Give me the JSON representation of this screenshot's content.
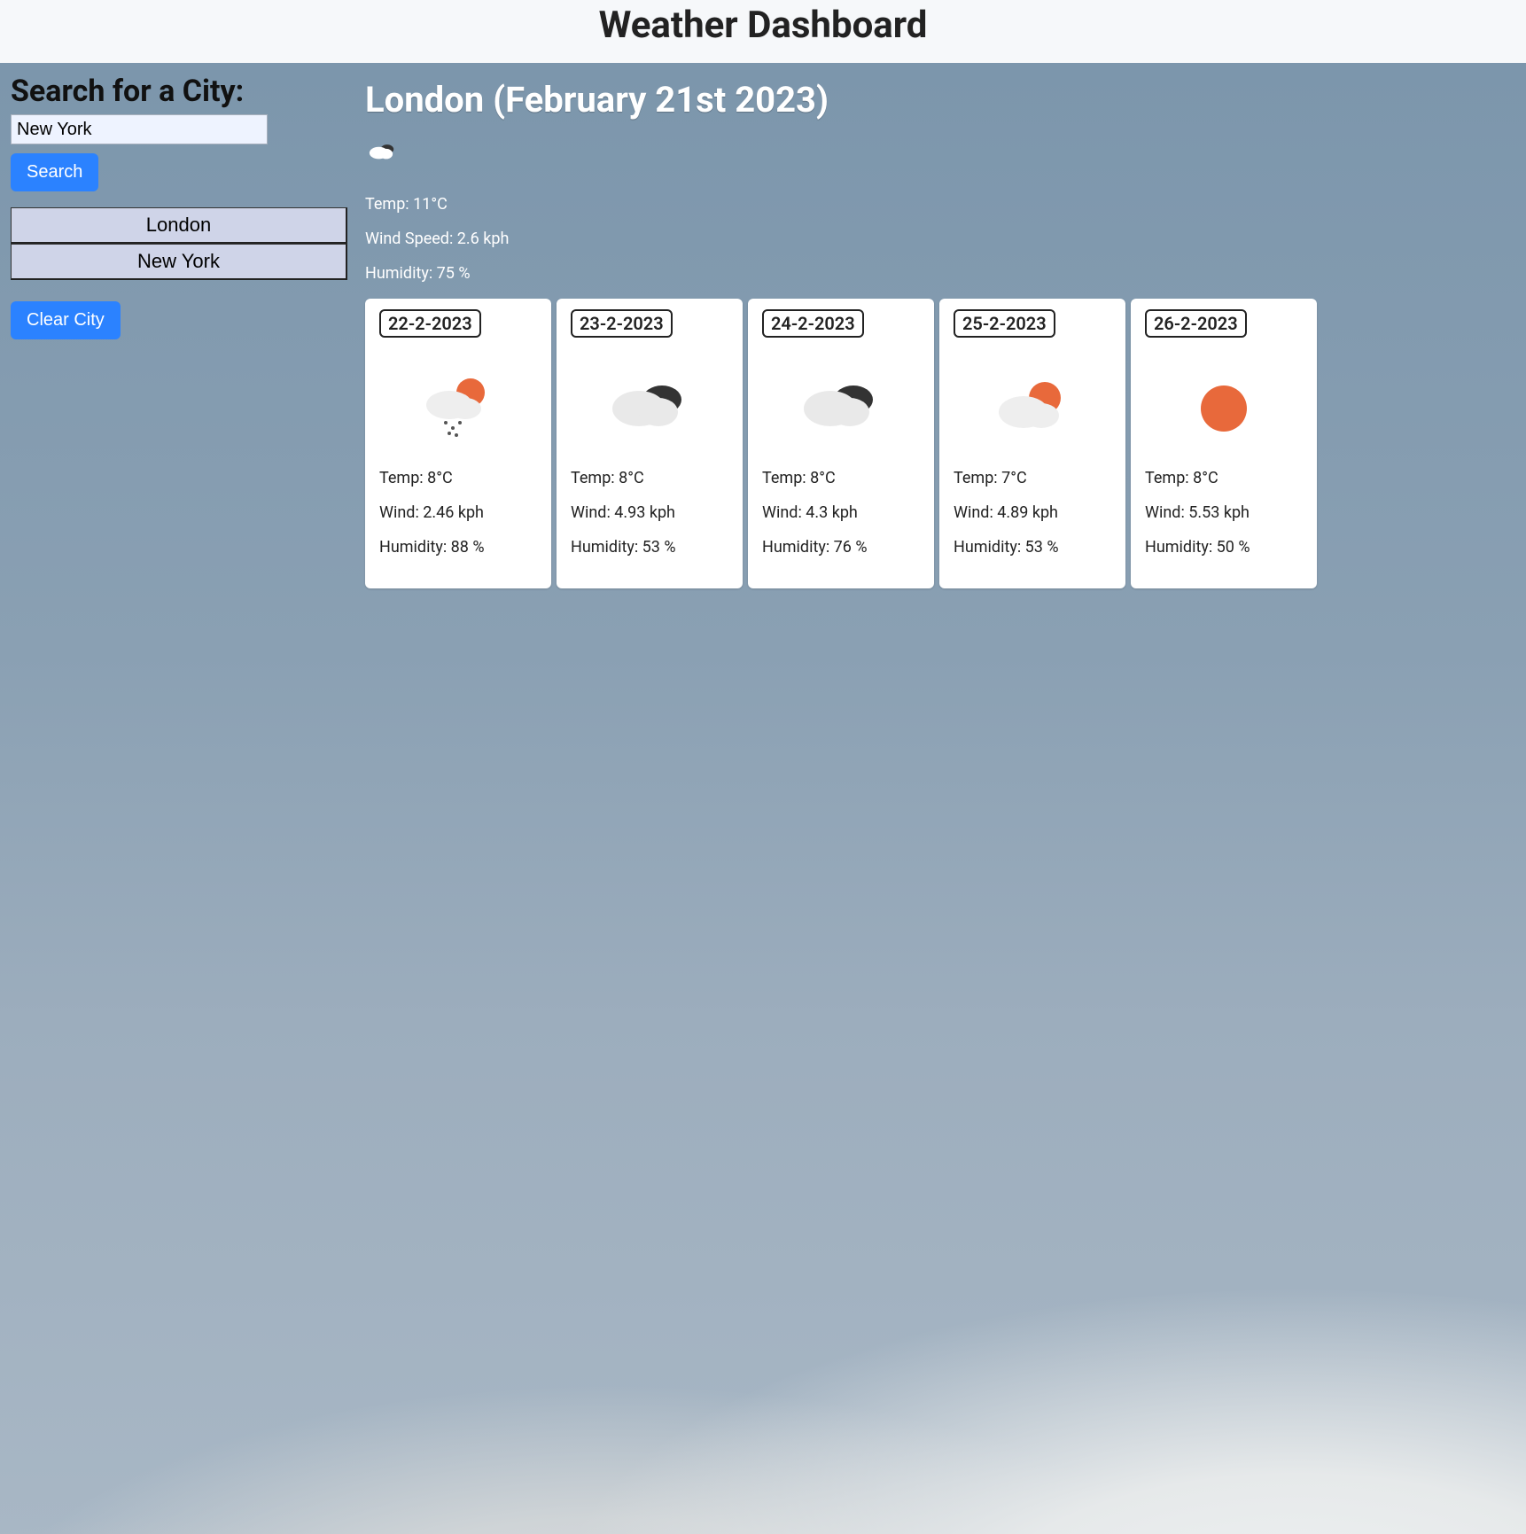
{
  "header": {
    "title": "Weather Dashboard"
  },
  "sidebar": {
    "search_heading": "Search for a City:",
    "search_value": "New York",
    "search_placeholder": "New York",
    "search_button": "Search",
    "history": [
      "London",
      "New York"
    ],
    "clear_button": "Clear City"
  },
  "current": {
    "title": "London (February 21st 2023)",
    "icon": "cloudy",
    "temp_line": "Temp: 11°C",
    "wind_line": "Wind Speed: 2.6 kph",
    "humidity_line": "Humidity: 75 %"
  },
  "forecast": [
    {
      "date": "22-2-2023",
      "icon": "sun-snow",
      "temp_line": "Temp: 8°C",
      "wind_line": "Wind: 2.46 kph",
      "humidity_line": "Humidity: 88 %"
    },
    {
      "date": "23-2-2023",
      "icon": "clouds",
      "temp_line": "Temp: 8°C",
      "wind_line": "Wind: 4.93 kph",
      "humidity_line": "Humidity: 53 %"
    },
    {
      "date": "24-2-2023",
      "icon": "clouds",
      "temp_line": "Temp: 8°C",
      "wind_line": "Wind: 4.3 kph",
      "humidity_line": "Humidity: 76 %"
    },
    {
      "date": "25-2-2023",
      "icon": "partly",
      "temp_line": "Temp: 7°C",
      "wind_line": "Wind: 4.89 kph",
      "humidity_line": "Humidity: 53 %"
    },
    {
      "date": "26-2-2023",
      "icon": "sunny",
      "temp_line": "Temp: 8°C",
      "wind_line": "Wind: 5.53 kph",
      "humidity_line": "Humidity: 50 %"
    }
  ]
}
